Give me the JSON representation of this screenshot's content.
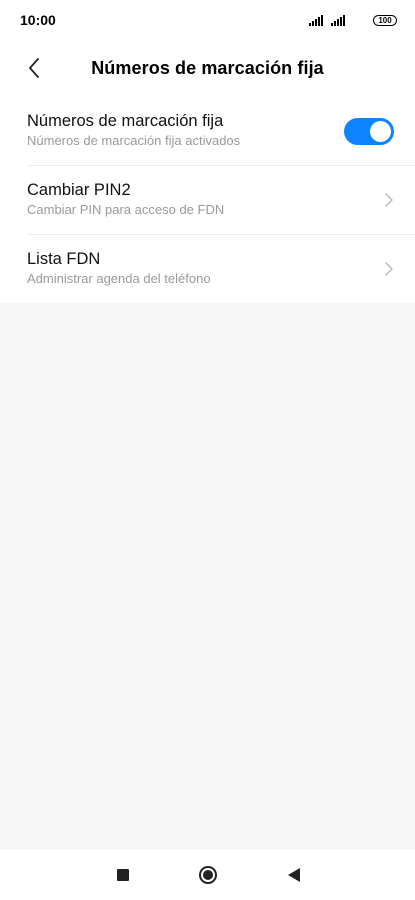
{
  "status_bar": {
    "time": "10:00",
    "battery": "100",
    "icons": [
      "signal-icon",
      "signal-icon",
      "battery-icon"
    ]
  },
  "header": {
    "title": "Números de marcación fija",
    "back_icon": "chevron-left-icon"
  },
  "settings": [
    {
      "title": "Números de marcación fija",
      "subtitle": "Números de marcación fija activados",
      "control": "toggle",
      "enabled": true
    },
    {
      "title": "Cambiar PIN2",
      "subtitle": "Cambiar PIN para acceso de FDN",
      "control": "chevron-right-icon"
    },
    {
      "title": "Lista FDN",
      "subtitle": "Administrar agenda del teléfono",
      "control": "chevron-right-icon"
    }
  ],
  "nav_bar": {
    "icons": [
      "recent-apps-icon",
      "home-icon",
      "back-icon"
    ]
  },
  "colors": {
    "accent": "#0d84ff",
    "background": "#f7f7f7",
    "subtitle": "#9a9a9a"
  }
}
